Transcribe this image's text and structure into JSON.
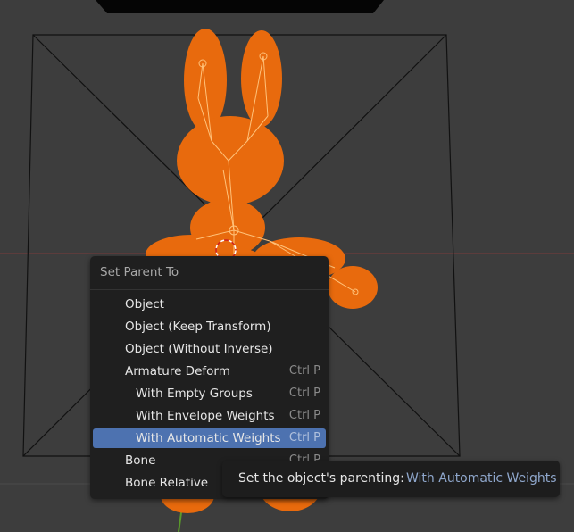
{
  "menu": {
    "title": "Set Parent To",
    "items": [
      {
        "label": "Object",
        "shortcut": ""
      },
      {
        "label": "Object (Keep Transform)",
        "shortcut": ""
      },
      {
        "label": "Object (Without Inverse)",
        "shortcut": ""
      },
      {
        "label": "Armature Deform",
        "shortcut": "Ctrl P"
      },
      {
        "label": "With Empty Groups",
        "shortcut": "Ctrl P"
      },
      {
        "label": "With Envelope Weights",
        "shortcut": "Ctrl P"
      },
      {
        "label": "With Automatic Weights",
        "shortcut": "Ctrl P"
      },
      {
        "label": "Bone",
        "shortcut": "Ctrl P"
      },
      {
        "label": "Bone Relative",
        "shortcut": ""
      }
    ]
  },
  "tooltip": {
    "label": "Set the object's parenting:",
    "value": "With Automatic Weights"
  },
  "colors": {
    "viewport_bg": "#3d3d3d",
    "mesh_orange": "#e86a0d",
    "highlight_blue": "#4d72b0",
    "tooltip_value": "#8fa7cc"
  }
}
